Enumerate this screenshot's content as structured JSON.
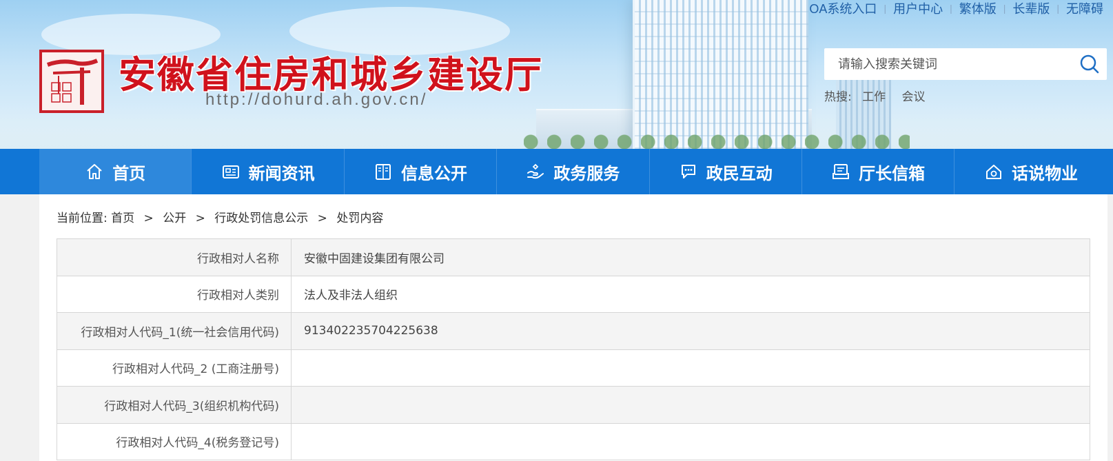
{
  "top_links": [
    "OA系统入口",
    "用户中心",
    "繁体版",
    "长辈版",
    "无障碍"
  ],
  "header": {
    "site_name": "安徽省住房和城乡建设厅",
    "site_url": "http://dohurd.ah.gov.cn/",
    "logo_icon": "seal-logo-icon"
  },
  "search": {
    "placeholder": "请输入搜索关键词",
    "hot_label": "热搜:",
    "hot_items": [
      "工作",
      "会议"
    ]
  },
  "nav": {
    "items": [
      {
        "label": "首页",
        "icon": "home-icon"
      },
      {
        "label": "新闻资讯",
        "icon": "news-icon"
      },
      {
        "label": "信息公开",
        "icon": "book-icon"
      },
      {
        "label": "政务服务",
        "icon": "service-icon"
      },
      {
        "label": "政民互动",
        "icon": "chat-icon"
      },
      {
        "label": "厅长信箱",
        "icon": "mailbox-icon"
      },
      {
        "label": "话说物业",
        "icon": "property-icon"
      }
    ]
  },
  "breadcrumb": {
    "prefix": "当前位置:",
    "items": [
      "首页",
      "公开",
      "行政处罚信息公示",
      "处罚内容"
    ],
    "separator": ">"
  },
  "table": {
    "rows": [
      {
        "label": "行政相对人名称",
        "value": "安徽中固建设集团有限公司"
      },
      {
        "label": "行政相对人类别",
        "value": "法人及非法人组织"
      },
      {
        "label": "行政相对人代码_1(统一社会信用代码)",
        "value": "913402235704225638"
      },
      {
        "label": "行政相对人代码_2 (工商注册号)",
        "value": ""
      },
      {
        "label": "行政相对人代码_3(组织机构代码)",
        "value": ""
      },
      {
        "label": "行政相对人代码_4(税务登记号)",
        "value": ""
      }
    ]
  },
  "colors": {
    "nav_bg": "#1176d6",
    "site_name": "#d0121c",
    "link": "#1f5fa6"
  }
}
